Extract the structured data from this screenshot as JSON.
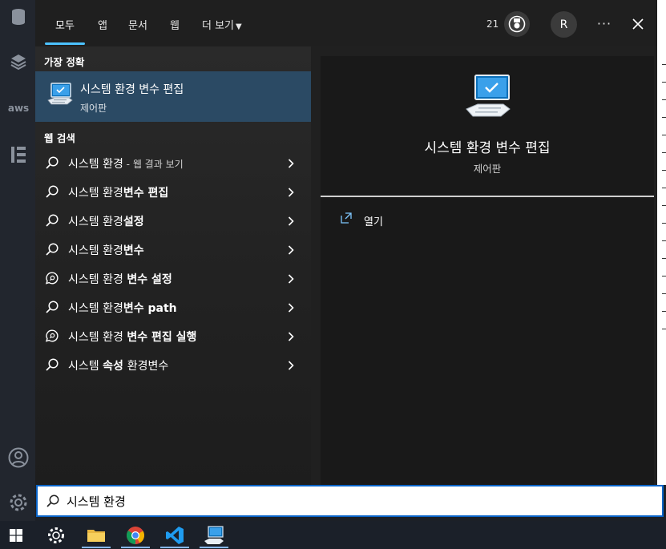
{
  "tabs": [
    {
      "label": "모두"
    },
    {
      "label": "앱"
    },
    {
      "label": "문서"
    },
    {
      "label": "웹"
    },
    {
      "label": "더 보기"
    }
  ],
  "header": {
    "points": "21",
    "avatar_initial": "R",
    "more_label": "···"
  },
  "best_match": {
    "section_label": "가장 정확",
    "title": "시스템 환경 변수 편집",
    "subtitle": "제어판"
  },
  "web_search": {
    "section_label": "웹 검색",
    "rows": [
      {
        "icon": "search-icon",
        "text": "시스템 환경",
        "bold": "",
        "suffix": " - 웹 결과 보기"
      },
      {
        "icon": "search-icon",
        "text": "시스템 환경",
        "bold": "변수 편집",
        "suffix": ""
      },
      {
        "icon": "search-icon",
        "text": "시스템 환경",
        "bold": "설정",
        "suffix": ""
      },
      {
        "icon": "search-icon",
        "text": "시스템 환경",
        "bold": "변수",
        "suffix": ""
      },
      {
        "icon": "chat-search-icon",
        "text": "시스템 환경 ",
        "bold": "변수 설정",
        "suffix": ""
      },
      {
        "icon": "search-icon",
        "text": "시스템 환경",
        "bold": "변수 path",
        "suffix": ""
      },
      {
        "icon": "chat-search-icon",
        "text": "시스템 환경 ",
        "bold": "변수 편집 실행",
        "suffix": ""
      },
      {
        "icon": "search-icon",
        "text": "시스템 ",
        "bold": "속성 ",
        "suffix": "",
        "after": "환경변수"
      }
    ]
  },
  "preview": {
    "title": "시스템 환경 변수 편집",
    "subtitle": "제어판",
    "open_label": "열기"
  },
  "search": {
    "value": "시스템 환경"
  },
  "colors": {
    "accent": "#4cc2ff",
    "selected_row": "#2b4a64",
    "search_border": "#0a64c8"
  }
}
